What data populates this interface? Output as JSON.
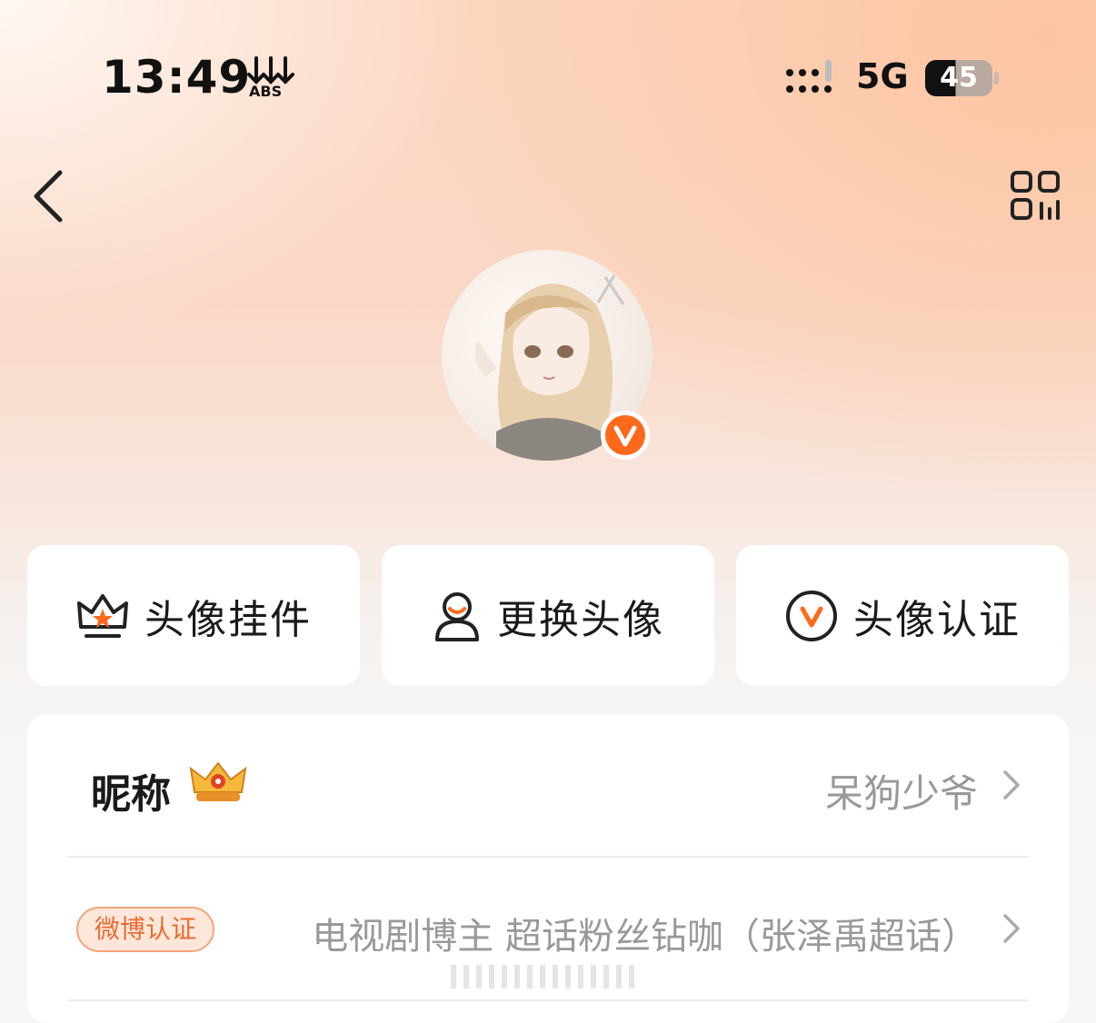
{
  "status_bar": {
    "time": "13:49",
    "sub_icon": "abs-icon",
    "signal_icon": "signal-icon",
    "network": "5G",
    "battery": "45"
  },
  "nav": {
    "back_icon": "chevron-left-icon",
    "qr_icon": "qr-code-icon"
  },
  "avatar": {
    "image": "anime-girl-avatar",
    "badge": "verified-v-badge",
    "badge_color": "#ff6a1a"
  },
  "actions": [
    {
      "icon": "crown-frame-icon",
      "label": "头像挂件"
    },
    {
      "icon": "person-icon",
      "label": "更换头像"
    },
    {
      "icon": "verify-v-icon",
      "label": "头像认证"
    }
  ],
  "profile": {
    "nickname_label": "昵称",
    "nickname_badge": "crown-badge-icon",
    "nickname_value": "呆狗少爷",
    "cert_tag": "微博认证",
    "cert_value": "电视剧博主 超话粉丝钻咖（张泽禹超话）"
  },
  "accent_color": "#ff6a1a"
}
